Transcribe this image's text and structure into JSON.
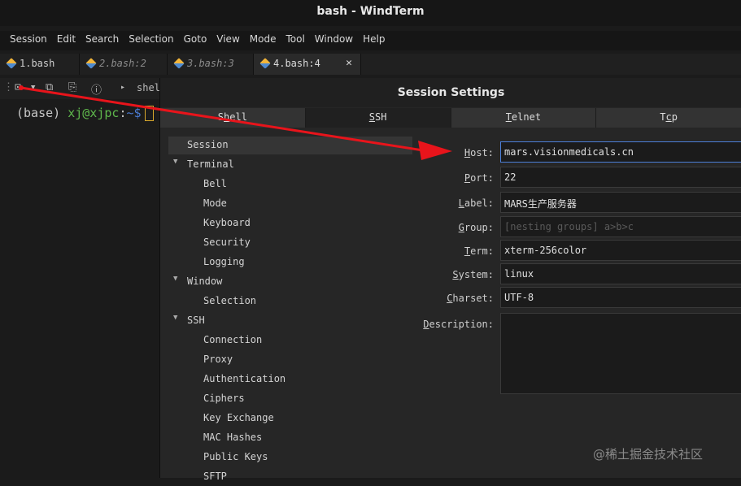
{
  "window": {
    "title": "bash - WindTerm"
  },
  "menu": [
    "Session",
    "Edit",
    "Search",
    "Selection",
    "Goto",
    "View",
    "Mode",
    "Tool",
    "Window",
    "Help"
  ],
  "tabs": [
    {
      "label": "1.bash"
    },
    {
      "label": "2.bash:2"
    },
    {
      "label": "3.bash:3"
    },
    {
      "label": "4.bash:4"
    }
  ],
  "toolbar": {
    "shell_label": "shel"
  },
  "terminal": {
    "env": "(base)",
    "user": "xj@xjpc",
    "sep": ":",
    "path": "~$"
  },
  "dialog": {
    "title": "Session Settings",
    "tabs": [
      {
        "pre": "S",
        "ul": "h",
        "post": "ell"
      },
      {
        "pre": "",
        "ul": "S",
        "post": "SH"
      },
      {
        "pre": "",
        "ul": "T",
        "post": "elnet"
      },
      {
        "pre": "T",
        "ul": "c",
        "post": "p"
      }
    ],
    "tree": [
      {
        "label": "Session",
        "level": 0,
        "selected": true
      },
      {
        "label": "Terminal",
        "level": 0,
        "expandable": true
      },
      {
        "label": "Bell",
        "level": 1
      },
      {
        "label": "Mode",
        "level": 1
      },
      {
        "label": "Keyboard",
        "level": 1
      },
      {
        "label": "Security",
        "level": 1
      },
      {
        "label": "Logging",
        "level": 1
      },
      {
        "label": "Window",
        "level": 0,
        "expandable": true
      },
      {
        "label": "Selection",
        "level": 1
      },
      {
        "label": "SSH",
        "level": 0,
        "expandable": true
      },
      {
        "label": "Connection",
        "level": 1
      },
      {
        "label": "Proxy",
        "level": 1
      },
      {
        "label": "Authentication",
        "level": 1
      },
      {
        "label": "Ciphers",
        "level": 1
      },
      {
        "label": "Key Exchange",
        "level": 1
      },
      {
        "label": "MAC Hashes",
        "level": 1
      },
      {
        "label": "Public Keys",
        "level": 1
      },
      {
        "label": "SFTP",
        "level": 1
      }
    ],
    "fields": {
      "host": {
        "pre": "",
        "ul": "H",
        "post": "ost:",
        "value": "mars.visionmedicals.cn"
      },
      "port": {
        "pre": "",
        "ul": "P",
        "post": "ort:",
        "value": "22"
      },
      "label": {
        "pre": "",
        "ul": "L",
        "post": "abel:",
        "value": "MARS生产服务器"
      },
      "group": {
        "pre": "",
        "ul": "G",
        "post": "roup:",
        "placeholder": "[nesting groups] a>b>c"
      },
      "term": {
        "pre": "",
        "ul": "T",
        "post": "erm:",
        "value": "xterm-256color"
      },
      "system": {
        "pre": "",
        "ul": "S",
        "post": "ystem:",
        "value": "linux"
      },
      "charset": {
        "pre": "",
        "ul": "C",
        "post": "harset:",
        "value": "UTF-8"
      },
      "description": {
        "pre": "",
        "ul": "D",
        "post": "escription:",
        "value": ""
      }
    }
  },
  "watermark": "@稀土掘金技术社区",
  "annotation": {
    "arrow_color": "#e8141b"
  }
}
